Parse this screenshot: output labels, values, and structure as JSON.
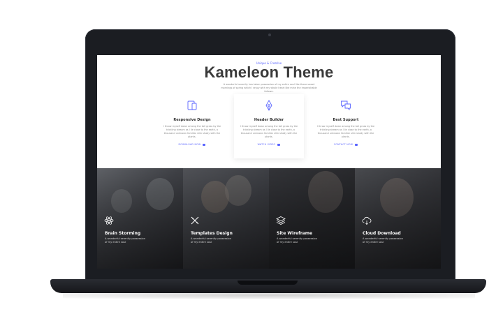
{
  "hero": {
    "eyebrow": "Unique & Creative",
    "title": "Kameleon Theme",
    "subtitle": "A wonderful serenity has taken possession of my entire soul like these sweet mornings of spring which I enjoy with my whole heart like mine the imperishable followe."
  },
  "features": [
    {
      "icon": "responsive-devices-icon",
      "title": "Responsive Design",
      "text": "I throw myself down among the tall grass by the trickling stream as I lie close to the earth, a thousand unknown familiar slim shady with the plants.",
      "link": "DOWNLOAD NOW"
    },
    {
      "icon": "pen-nib-icon",
      "title": "Header Builder",
      "text": "I throw myself down among the tall grass by the trickling stream as I lie close to the earth, a thousand unknown familiar slim shady with the plants.",
      "link": "WATCH VIDEO"
    },
    {
      "icon": "chat-bubbles-icon",
      "title": "Best Support",
      "text": "I throw myself down among the tall grass by the trickling stream as I lie close to the earth, a thousand unknown familiar slim shady with the plants.",
      "link": "CONTACT NOW"
    }
  ],
  "tiles": [
    {
      "icon": "atom-icon",
      "title": "Brain Storming",
      "text": "A wonderful serenity possession of my entire soul"
    },
    {
      "icon": "pencil-ruler-icon",
      "title": "Templates Design",
      "text": "A wonderful serenity possession of my entire soul"
    },
    {
      "icon": "layers-icon",
      "title": "Site Wireframe",
      "text": "A wonderful serenity possession of my entire soul"
    },
    {
      "icon": "cloud-download-icon",
      "title": "Cloud Download",
      "text": "A wonderful serenity possession of my entire soul"
    }
  ],
  "colors": {
    "accent": "#5863ff",
    "heading": "#3a3a3a",
    "laptop": "#1b1d22"
  }
}
